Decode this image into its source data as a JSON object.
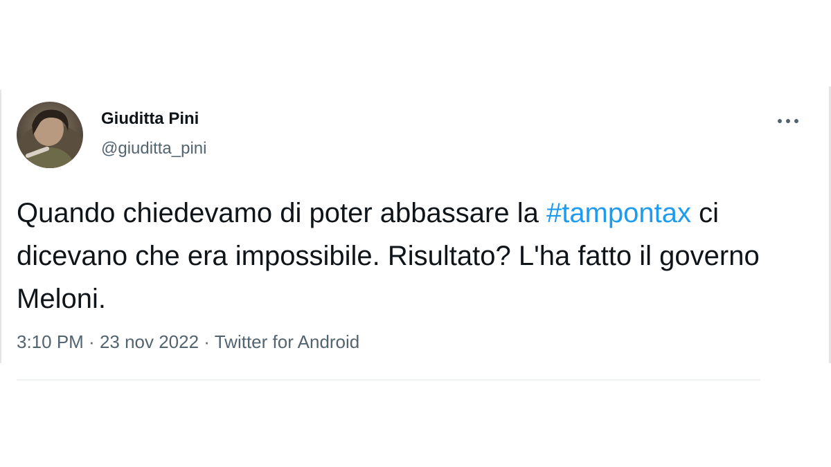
{
  "tweet": {
    "author": {
      "name": "Giuditta Pini",
      "handle": "@giuditta_pini"
    },
    "text_parts": {
      "line1_prefix": "Quando chiedevamo di poter abbassare la ",
      "hashtag": "#tampontax",
      "rest": " ci dicevano che era impossibile. Risultato? L'ha fatto il governo Meloni."
    },
    "meta": {
      "time": "3:10 PM",
      "separator1": " · ",
      "date": "23 nov 2022",
      "separator2": " · ",
      "source": "Twitter for Android"
    },
    "more_icon": "more-horizontal-icon"
  },
  "colors": {
    "text": "#0f1419",
    "secondary": "#536471",
    "link": "#1d9bf0",
    "divider": "#eff3f4"
  }
}
